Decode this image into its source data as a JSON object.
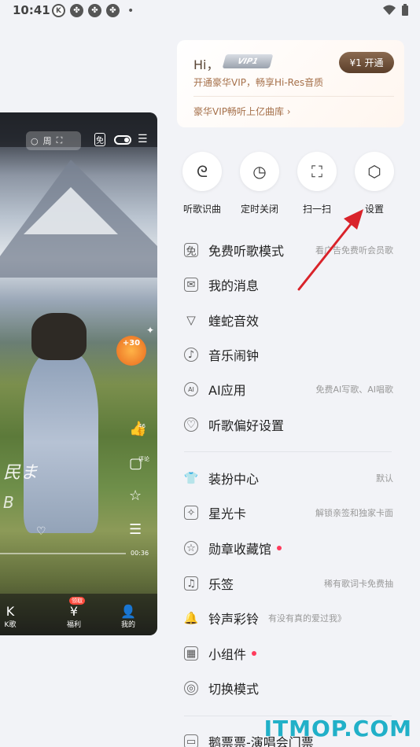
{
  "status_bar": {
    "time": "10:41",
    "icons": [
      "k-circle-icon",
      "pinwheel-icon",
      "pinwheel-icon",
      "pinwheel-icon"
    ],
    "dot": "•"
  },
  "player": {
    "search_text": "周",
    "vip_free_icon": "免",
    "bonus": "+30",
    "lyric_line1": "民ま",
    "lyric_line2": "B",
    "time": "00:36",
    "side_labels": {
      "comment": "评论",
      "like": "46"
    },
    "nav": [
      {
        "glyph": "K",
        "label": "K歌"
      },
      {
        "glyph": "¥",
        "label": "福利",
        "badge": "领取"
      },
      {
        "glyph": "👤",
        "label": "我的"
      }
    ]
  },
  "vip_card": {
    "greeting": "Hi，",
    "vip_logo": "VIP1",
    "subtitle": "开通豪华VIP，畅享Hi-Res音质",
    "button": "¥1 开通",
    "link": "豪华VIP畅听上亿曲库 ›"
  },
  "quick_actions": [
    {
      "icon": "song-recognition-icon",
      "label": "听歌识曲"
    },
    {
      "icon": "timer-close-icon",
      "label": "定时关闭"
    },
    {
      "icon": "scan-icon",
      "label": "扫一扫"
    },
    {
      "icon": "settings-icon",
      "label": "设置"
    }
  ],
  "menu_group1": [
    {
      "icon": "free-listen-icon",
      "label": "免费听歌模式",
      "right": "看广告免费听会员歌"
    },
    {
      "icon": "mail-icon",
      "label": "我的消息",
      "right": ""
    },
    {
      "icon": "viper-sound-icon",
      "label": "蝰蛇音效",
      "right": ""
    },
    {
      "icon": "alarm-icon",
      "label": "音乐闹钟",
      "right": ""
    },
    {
      "icon": "ai-app-icon",
      "label": "AI应用",
      "right": "免费AI写歌、AI唱歌"
    },
    {
      "icon": "preference-icon",
      "label": "听歌偏好设置",
      "right": ""
    }
  ],
  "menu_group2": [
    {
      "icon": "dress-up-icon",
      "label": "装扮中心",
      "right": "默认"
    },
    {
      "icon": "star-card-icon",
      "label": "星光卡",
      "right": "解锁亲签和独家卡面"
    },
    {
      "icon": "badge-museum-icon",
      "label": "勋章收藏馆",
      "right": ""
    },
    {
      "icon": "music-note-sign-icon",
      "label": "乐签",
      "right": "稀有歌词卡免费抽"
    },
    {
      "icon": "ringtone-icon",
      "label": "铃声彩铃",
      "inline": "有没有真的爱过我》"
    },
    {
      "icon": "widget-icon",
      "label": "小组件",
      "right": ""
    },
    {
      "icon": "switch-mode-icon",
      "label": "切换模式",
      "right": ""
    },
    {
      "icon": "ticket-icon",
      "label": "鹅票票-演唱会门票",
      "right": ""
    }
  ],
  "watermark": "ITMOP.COM",
  "colors": {
    "accent_red": "#ff3b5c",
    "vip_brown": "#a5704a",
    "arrow_red": "#d9232a",
    "watermark": "#21b0c8"
  }
}
